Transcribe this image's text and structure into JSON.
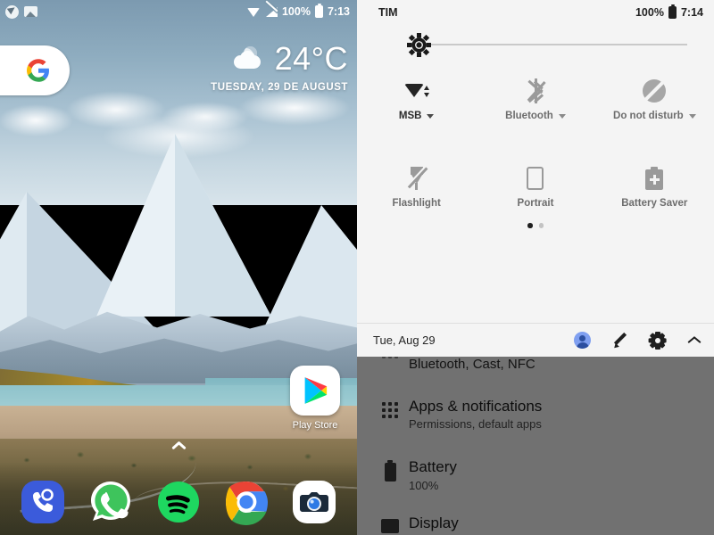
{
  "home": {
    "status_bar": {
      "notification_icons": [
        "location-arrow-icon",
        "photo-icon"
      ],
      "wifi_icon": "wifi-icon",
      "signal_icon": "cellular-signal-off-icon",
      "battery_percent": "100%",
      "battery_icon": "battery-full-icon",
      "clock": "7:13"
    },
    "search_widget": {
      "logo": "google-g-logo"
    },
    "weather_widget": {
      "icon": "cloud-moon-icon",
      "temperature": "24°C",
      "date": "TUESDAY, 29 DE AUGUST"
    },
    "app_icons": [
      {
        "name": "play-store",
        "label": "Play Store"
      }
    ],
    "drawer_handle": "chevron-up-icon",
    "dock": [
      {
        "name": "phone",
        "label": "Phone",
        "color": "#3b5bdb"
      },
      {
        "name": "whatsapp",
        "label": "WhatsApp",
        "color": "#3ec45c"
      },
      {
        "name": "spotify",
        "label": "Spotify",
        "color": "#1ed760"
      },
      {
        "name": "chrome",
        "label": "Chrome",
        "color": "#4285f4"
      },
      {
        "name": "camera",
        "label": "Camera",
        "color": "#ffffff"
      }
    ]
  },
  "quick_settings": {
    "status_bar": {
      "carrier": "TIM",
      "battery_percent": "100%",
      "battery_icon": "battery-full-icon",
      "clock": "7:14"
    },
    "brightness": {
      "icon": "brightness-sun-icon",
      "value_percent": 8
    },
    "tiles": [
      {
        "name": "wifi",
        "label": "MSB",
        "icon": "wifi-icon",
        "enabled": true,
        "has_caret": true
      },
      {
        "name": "bluetooth",
        "label": "Bluetooth",
        "icon": "bluetooth-off-icon",
        "enabled": false,
        "has_caret": true
      },
      {
        "name": "do-not-disturb",
        "label": "Do not disturb",
        "icon": "do-not-disturb-icon",
        "enabled": false,
        "has_caret": true
      },
      {
        "name": "flashlight",
        "label": "Flashlight",
        "icon": "flashlight-off-icon",
        "enabled": false,
        "has_caret": false
      },
      {
        "name": "portrait",
        "label": "Portrait",
        "icon": "rotation-lock-icon",
        "enabled": false,
        "has_caret": false
      },
      {
        "name": "battery-saver",
        "label": "Battery Saver",
        "icon": "battery-saver-icon",
        "enabled": false,
        "has_caret": false
      }
    ],
    "pages": {
      "count": 2,
      "active_index": 0
    },
    "footer": {
      "date": "Tue, Aug 29",
      "actions": [
        {
          "name": "user",
          "icon": "user-avatar-icon",
          "color": "#7f9ff0"
        },
        {
          "name": "edit",
          "icon": "pencil-icon"
        },
        {
          "name": "settings",
          "icon": "gear-icon"
        },
        {
          "name": "collapse",
          "icon": "chevron-up-icon"
        }
      ]
    }
  },
  "settings_list": {
    "rows": [
      {
        "name": "connected-devices",
        "icon": "devices-icon",
        "title": "",
        "subtitle": "Bluetooth, Cast, NFC",
        "partial": true
      },
      {
        "name": "apps-notifications",
        "icon": "grid-apps-icon",
        "title": "Apps & notifications",
        "subtitle": "Permissions, default apps",
        "partial": false
      },
      {
        "name": "battery",
        "icon": "battery-icon",
        "title": "Battery",
        "subtitle": "100%",
        "partial": false
      },
      {
        "name": "display",
        "icon": "display-icon",
        "title": "Display",
        "subtitle": "",
        "partial": true
      }
    ]
  }
}
